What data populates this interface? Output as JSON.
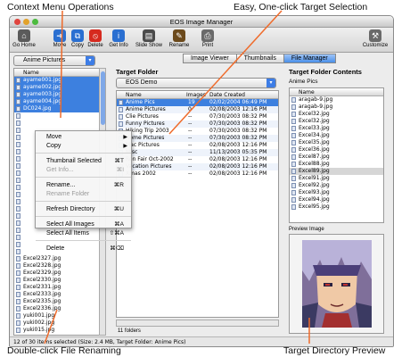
{
  "callouts": {
    "top_left": "Context Menu Operations",
    "top_right": "Easy, One-click Target Selection",
    "bottom_left": "Double-click File Renaming",
    "bottom_right": "Target Directory Preview"
  },
  "window": {
    "title": "EOS Image Manager",
    "toolbar": [
      {
        "label": "Go Home",
        "icon": "home-icon",
        "color": "#5b5b5b"
      },
      {
        "label": "Move",
        "icon": "move-icon",
        "color": "#2a6fd1"
      },
      {
        "label": "Copy",
        "icon": "copy-icon",
        "color": "#2a6fd1"
      },
      {
        "label": "Delete",
        "icon": "delete-icon",
        "color": "#d62a1f"
      },
      {
        "label": "Get Info",
        "icon": "info-icon",
        "color": "#2a6fd1"
      },
      {
        "label": "Slide Show",
        "icon": "slideshow-icon",
        "color": "#4b4b4b"
      },
      {
        "label": "Rename",
        "icon": "rename-icon",
        "color": "#6c4a1c"
      },
      {
        "label": "Print",
        "icon": "print-icon",
        "color": "#6a6a6a"
      },
      {
        "label": "Customize",
        "icon": "customize-icon",
        "color": "#6a6a6a"
      }
    ]
  },
  "left": {
    "folder": "Anime Pictures",
    "column": "Name",
    "files": [
      "ayame001.jpg",
      "ayame002.jpg",
      "ayame003.jpg",
      "ayame004.jpg",
      "DC024.jpg",
      "",
      "",
      "",
      "",
      "",
      "",
      "",
      "",
      "",
      "",
      "",
      "",
      "",
      "",
      "",
      "",
      "",
      "",
      "",
      "",
      "Excel2327.jpg",
      "Excel2328.jpg",
      "Excel2329.jpg",
      "Excel2330.jpg",
      "Excel2331.jpg",
      "Excel2333.jpg",
      "Excel2335.jpg",
      "Excel2336.jpg",
      "yuki001.jpg",
      "yuki002.jpg",
      "yuki015.jpg"
    ]
  },
  "context_menu": {
    "items": [
      {
        "label": "Move",
        "shortcut": "",
        "submenu": true,
        "disabled": false
      },
      {
        "label": "Copy",
        "shortcut": "",
        "submenu": true,
        "disabled": false
      },
      {
        "sep": true
      },
      {
        "label": "Thumbnail Selected",
        "shortcut": "⌘T",
        "submenu": false,
        "disabled": false
      },
      {
        "label": "Get Info...",
        "shortcut": "⌘I",
        "submenu": false,
        "disabled": true
      },
      {
        "sep": true
      },
      {
        "label": "Rename...",
        "shortcut": "⌘R",
        "submenu": false,
        "disabled": false
      },
      {
        "label": "Rename Folder",
        "shortcut": "",
        "submenu": false,
        "disabled": true
      },
      {
        "sep": true
      },
      {
        "label": "Refresh Directory",
        "shortcut": "⌘U",
        "submenu": false,
        "disabled": false
      },
      {
        "sep": true
      },
      {
        "label": "Select All Images",
        "shortcut": "⌘A",
        "submenu": false,
        "disabled": false
      },
      {
        "label": "Select All Items",
        "shortcut": "⇧⌘A",
        "submenu": false,
        "disabled": false
      },
      {
        "sep": true
      },
      {
        "label": "Delete",
        "shortcut": "⌘⌫",
        "submenu": false,
        "disabled": false
      }
    ]
  },
  "tabs": [
    "Image Viewer",
    "Thumbnails",
    "File Manager"
  ],
  "target": {
    "title": "Target Folder",
    "folder": "EOS Demo",
    "columns": [
      "Name",
      "Images",
      "Date Created"
    ],
    "rows": [
      {
        "name": "Anime Pics",
        "images": "19",
        "date": "02/02/2004 06:49 PM",
        "sel": true
      },
      {
        "name": "Anime Pictures",
        "images": "0",
        "date": "02/08/2003 12:16 PM",
        "sel": false
      },
      {
        "name": "Clie Pictures",
        "images": "--",
        "date": "07/30/2003 08:32 PM",
        "sel": false
      },
      {
        "name": "Funny Pictures",
        "images": "--",
        "date": "07/30/2003 08:32 PM",
        "sel": false
      },
      {
        "name": "Hiking Trip 2003",
        "images": "--",
        "date": "07/30/2003 08:32 PM",
        "sel": false
      },
      {
        "name": "Home Pictures",
        "images": "--",
        "date": "07/30/2003 08:32 PM",
        "sel": false
      },
      {
        "name": "Mac Pictures",
        "images": "--",
        "date": "02/08/2003 12:16 PM",
        "sel": false
      },
      {
        "name": "Misc",
        "images": "--",
        "date": "11/13/2003 05:35 PM",
        "sel": false
      },
      {
        "name": "Ren Fair Oct-2002",
        "images": "--",
        "date": "02/08/2003 12:16 PM",
        "sel": false
      },
      {
        "name": "Vacation Pictures",
        "images": "--",
        "date": "02/08/2003 12:16 PM",
        "sel": false
      },
      {
        "name": "Xmas 2002",
        "images": "--",
        "date": "02/08/2003 12:16 PM",
        "sel": false
      }
    ],
    "count": "11 folders"
  },
  "contents": {
    "title": "Target Folder Contents",
    "folder": "Anime Pics",
    "column": "Name",
    "files": [
      "aragab-9.jpg",
      "aragab-9.jpg",
      "Excel32.jpg",
      "Excel32.jpg",
      "Excel33.jpg",
      "Excel34.jpg",
      "Excel35.jpg",
      "Excel36.jpg",
      "Excel87.jpg",
      "Excel88.jpg",
      "Excel89.jpg",
      "Excel91.jpg",
      "Excel92.jpg",
      "Excel93.jpg",
      "Excel94.jpg",
      "Excel95.jpg"
    ],
    "highlight_index": 10,
    "preview_label": "Preview Image"
  },
  "status": "12 of 30 items selected (Size: 2.4 MB, Target Folder: Anime Pics)"
}
